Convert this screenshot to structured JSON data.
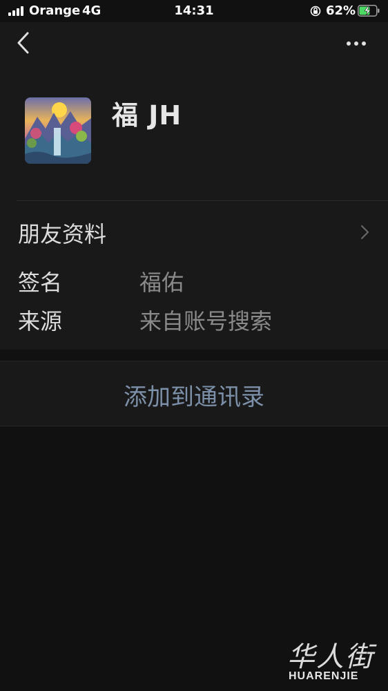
{
  "status_bar": {
    "carrier": "Orange",
    "network": "4G",
    "time": "14:31",
    "battery_percent": "62%",
    "battery_level": 0.62,
    "icons": [
      "signal-icon",
      "orientation-lock-icon",
      "battery-charging-icon"
    ]
  },
  "nav": {
    "back_icon": "chevron-left-icon",
    "more_icon": "more-dots-icon"
  },
  "profile": {
    "name": "福 JH",
    "avatar": "landscape-waterfall-avatar"
  },
  "info": {
    "section_title": "朋友资料",
    "rows": [
      {
        "label": "签名",
        "value": "福佑"
      },
      {
        "label": "来源",
        "value": "来自账号搜索"
      }
    ]
  },
  "actions": {
    "add_contact": "添加到通讯录"
  },
  "watermark": {
    "logo": "华人街",
    "text": "HUARENJIE"
  },
  "colors": {
    "background": "#111111",
    "card": "#191919",
    "link": "#7d90a9",
    "secondary_text": "#8a8a8a"
  }
}
